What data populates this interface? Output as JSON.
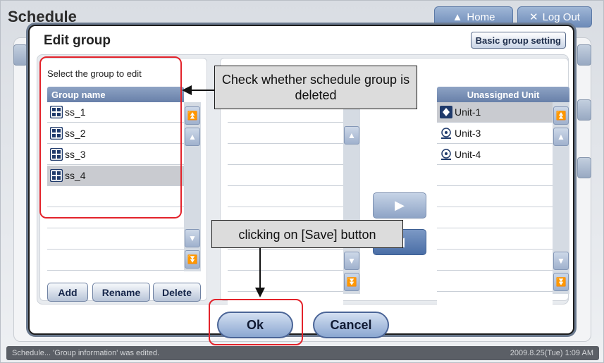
{
  "app": {
    "title": "Schedule",
    "home_label": "Home",
    "logout_label": "Log Out",
    "status_text": "Schedule... 'Group information' was edited.",
    "timestamp": "2009.8.25(Tue) 1:09 AM"
  },
  "dialog": {
    "title": "Edit group",
    "basic_setting_label": "Basic group setting",
    "select_caption": "Select the group to edit",
    "group_header": "Group name",
    "groups": [
      "ss_1",
      "ss_2",
      "ss_3",
      "ss_4"
    ],
    "selected_group": "ss_4",
    "add_label": "Add",
    "rename_label": "Rename",
    "delete_label": "Delete",
    "unassigned_header": "Unassigned Unit",
    "units": [
      "Unit-1",
      "Unit-3",
      "Unit-4"
    ],
    "selected_unit": "Unit-1",
    "ok_label": "Ok",
    "cancel_label": "Cancel"
  },
  "annotations": {
    "callout_1": "Check whether schedule group is deleted",
    "callout_2": "clicking on [Save] button"
  },
  "icons": {
    "group": "group-grid-icon",
    "unit_indoor": "indoor-unit-icon",
    "unit_ahu": "ahu-unit-icon",
    "scroll_top": "double-chevron-up-icon",
    "scroll_up": "chevron-up-icon",
    "scroll_down": "chevron-down-icon",
    "scroll_bottom": "double-chevron-down-icon",
    "move_right": "triangle-right-icon",
    "move_left": "triangle-left-icon"
  },
  "colors": {
    "highlight_red": "#e3232b",
    "header_blue": "#7891b8",
    "selected_row": "#c9cbd0"
  }
}
